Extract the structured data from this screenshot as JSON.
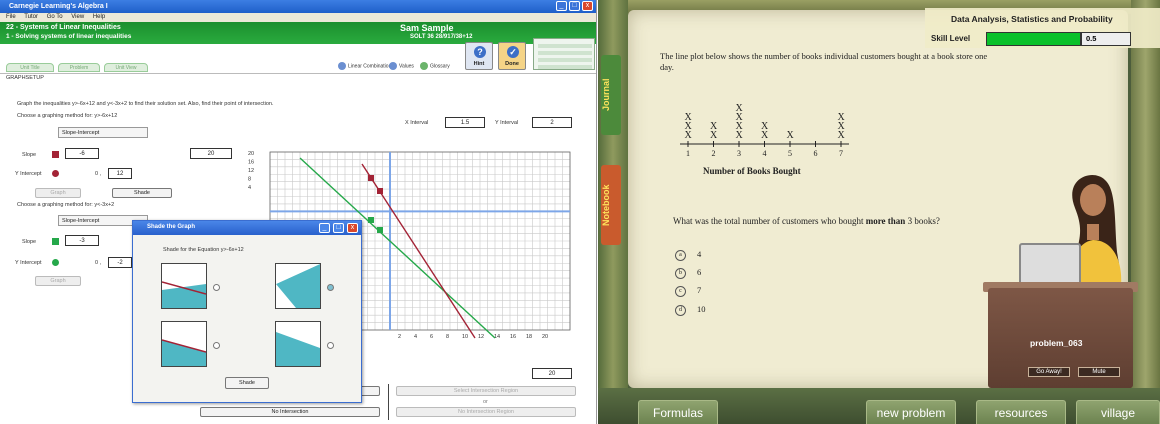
{
  "left": {
    "window_title": "Carnegie Learning's Algebra I",
    "menu": [
      "File",
      "Tutor",
      "Go To",
      "View",
      "Help"
    ],
    "unit_title": "22 - Systems of Linear Inequalities",
    "section_title": "1 - Solving systems of linear inequalities",
    "student_name": "Sam Sample",
    "student_code": "SOLT 36 28/917/38+12",
    "buttons": {
      "hint": "Hint",
      "done": "Done"
    },
    "tabs": [
      "Unit Title",
      "Problem",
      "Unit View"
    ],
    "tools": [
      "Linear Combination",
      "Values",
      "Glossary"
    ],
    "section_label": "GRAPHSETUP",
    "instruction": "Graph the inequalities y>-6x+12 and y<-3x+2 to find their solution set. Also, find their point of intersection.",
    "choose_method_1": "Choose a graphing method for: y>-6x+12",
    "choose_method_2": "Choose a graphing method for: y<-3x+2",
    "method_value": "Slope-Intercept",
    "x_interval_label": "X Interval",
    "x_interval_value": "1.5",
    "y_interval_label": "Y Interval",
    "y_interval_value": "2",
    "slope_label": "Slope",
    "y_intercept_label": "Y Intercept",
    "slope1": "-6",
    "intercept1": "12",
    "slope2": "-3",
    "intercept2": "-2",
    "y_max_value": "20",
    "x_max_value": "20",
    "graph_button": "Graph",
    "shade_button": "Shade",
    "y_ticks": [
      "20",
      "16",
      "12",
      "8",
      "4"
    ],
    "x_ticks": [
      "2",
      "4",
      "6",
      "8",
      "10",
      "12",
      "14",
      "16",
      "18",
      "20"
    ],
    "popup": {
      "title": "Shade the Graph",
      "subtitle": "Shade for the Equation y>-6x+12",
      "shade_button": "Shade"
    },
    "select_region": "Select Intersection Region",
    "or_text": "or",
    "no_intersection": "No Intersection",
    "no_intersection_region": "No Intersection Region"
  },
  "right": {
    "category": "Data Analysis, Statistics and Probability",
    "skill_label": "Skill Level",
    "skill_value": "0.5",
    "skill_fraction": 0.5,
    "question": "The line plot below shows the number of books individual customers bought at a book store one day.",
    "chart_data": {
      "type": "scatter",
      "x": [
        1,
        2,
        3,
        4,
        5,
        6,
        7
      ],
      "counts": [
        3,
        2,
        4,
        2,
        1,
        0,
        3
      ],
      "marker": "X",
      "xlabel": "Number of Books Bought"
    },
    "tick_labels": [
      "1",
      "2",
      "3",
      "4",
      "5",
      "6",
      "7"
    ],
    "question2_pre": "What was the total number of customers who bought ",
    "question2_bold": "more than",
    "question2_post": " 3 books?",
    "options": [
      {
        "letter": "a",
        "text": "4"
      },
      {
        "letter": "b",
        "text": "6"
      },
      {
        "letter": "c",
        "text": "7"
      },
      {
        "letter": "d",
        "text": "10"
      }
    ],
    "desk_label": "problem_063",
    "desk_buttons": [
      "Go Away!",
      "Mute"
    ],
    "side_labels": [
      "Journal",
      "Notebook"
    ],
    "bottom_tabs": [
      "Formulas",
      "new problem",
      "resources",
      "village"
    ]
  }
}
